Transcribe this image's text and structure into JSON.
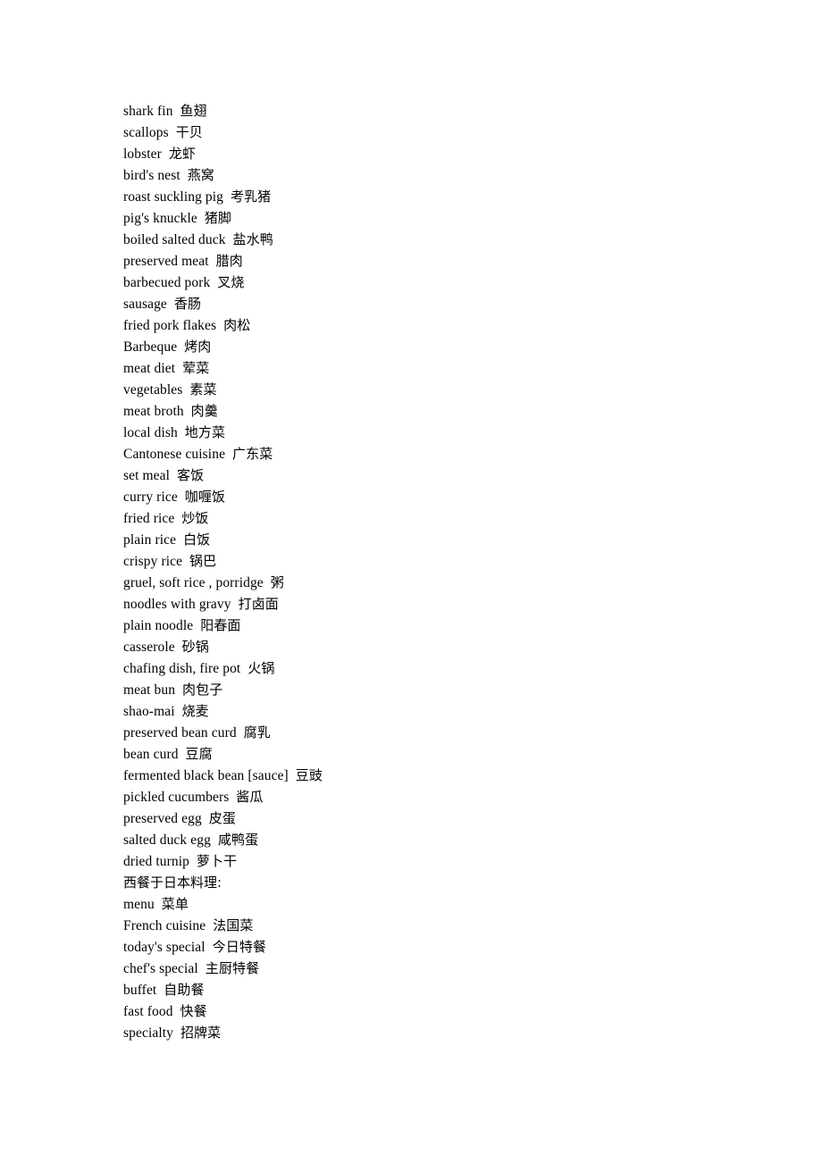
{
  "page": {
    "background_color": "#ffffff",
    "text_color": "#000000",
    "document_title": "Food Vocabulary List"
  },
  "lines": [
    {
      "type": "entry",
      "english": "shark fin",
      "chinese": "鱼翅"
    },
    {
      "type": "entry",
      "english": "scallops",
      "chinese": "干贝"
    },
    {
      "type": "entry",
      "english": "lobster",
      "chinese": "龙虾"
    },
    {
      "type": "entry",
      "english": "bird's nest",
      "chinese": "燕窝"
    },
    {
      "type": "entry",
      "english": "roast suckling pig",
      "chinese": "考乳猪"
    },
    {
      "type": "entry",
      "english": "pig's knuckle",
      "chinese": "猪脚"
    },
    {
      "type": "entry",
      "english": "boiled salted duck",
      "chinese": "盐水鸭"
    },
    {
      "type": "entry",
      "english": "preserved meat",
      "chinese": "腊肉"
    },
    {
      "type": "entry",
      "english": "barbecued pork",
      "chinese": "叉烧"
    },
    {
      "type": "entry",
      "english": "sausage",
      "chinese": "香肠"
    },
    {
      "type": "entry",
      "english": "fried pork flakes",
      "chinese": "肉松"
    },
    {
      "type": "entry",
      "english": "Barbeque",
      "chinese": "烤肉"
    },
    {
      "type": "entry",
      "english": "meat diet",
      "chinese": "荤菜"
    },
    {
      "type": "entry",
      "english": "vegetables",
      "chinese": "素菜"
    },
    {
      "type": "entry",
      "english": "meat broth",
      "chinese": "肉羹"
    },
    {
      "type": "entry",
      "english": "local dish",
      "chinese": "地方菜"
    },
    {
      "type": "entry",
      "english": "Cantonese cuisine",
      "chinese": "广东菜"
    },
    {
      "type": "entry",
      "english": "set meal",
      "chinese": "客饭"
    },
    {
      "type": "entry",
      "english": "curry rice",
      "chinese": "咖喱饭"
    },
    {
      "type": "entry",
      "english": "fried rice",
      "chinese": "炒饭"
    },
    {
      "type": "entry",
      "english": "plain rice",
      "chinese": "白饭"
    },
    {
      "type": "entry",
      "english": "crispy rice",
      "chinese": "锅巴"
    },
    {
      "type": "entry",
      "english": "gruel, soft rice , porridge",
      "chinese": "粥"
    },
    {
      "type": "entry",
      "english": "noodles with gravy",
      "chinese": "打卤面"
    },
    {
      "type": "entry",
      "english": "plain noodle",
      "chinese": "阳春面"
    },
    {
      "type": "entry",
      "english": "casserole",
      "chinese": "砂锅"
    },
    {
      "type": "entry",
      "english": "chafing dish, fire pot",
      "chinese": "火锅"
    },
    {
      "type": "entry",
      "english": "meat bun",
      "chinese": "肉包子"
    },
    {
      "type": "entry",
      "english": "shao-mai",
      "chinese": "烧麦"
    },
    {
      "type": "entry",
      "english": "preserved bean curd",
      "chinese": "腐乳"
    },
    {
      "type": "entry",
      "english": "bean curd",
      "chinese": "豆腐"
    },
    {
      "type": "entry",
      "english": "fermented black bean [sauce]",
      "chinese": "豆豉"
    },
    {
      "type": "entry",
      "english": "pickled cucumbers",
      "chinese": "酱瓜"
    },
    {
      "type": "entry",
      "english": "preserved egg",
      "chinese": "皮蛋"
    },
    {
      "type": "entry",
      "english": "salted duck egg",
      "chinese": "咸鸭蛋"
    },
    {
      "type": "entry",
      "english": "dried turnip",
      "chinese": "萝卜干"
    },
    {
      "type": "heading",
      "text": "西餐于日本料理:"
    },
    {
      "type": "entry",
      "english": "menu",
      "chinese": "菜单"
    },
    {
      "type": "entry",
      "english": "French cuisine",
      "chinese": "法国菜"
    },
    {
      "type": "entry",
      "english": "today's special",
      "chinese": "今日特餐"
    },
    {
      "type": "entry",
      "english": "chef's special",
      "chinese": "主厨特餐"
    },
    {
      "type": "entry",
      "english": "buffet",
      "chinese": "自助餐"
    },
    {
      "type": "entry",
      "english": "fast food",
      "chinese": "快餐"
    },
    {
      "type": "entry",
      "english": "specialty",
      "chinese": "招牌菜"
    }
  ]
}
